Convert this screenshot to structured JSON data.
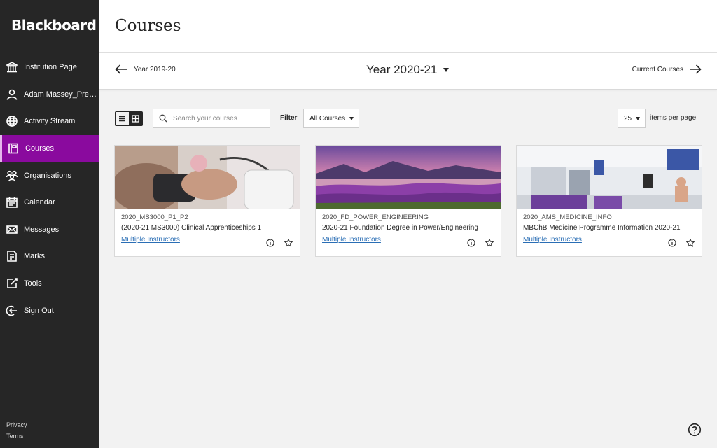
{
  "app": {
    "logo": "Blackboard",
    "accent": "#8a0a9e",
    "sidebar_bg": "#262626"
  },
  "sidebar": {
    "items": [
      {
        "label": "Institution Page",
        "icon": "institution-icon"
      },
      {
        "label": "Adam Massey_Previ...",
        "icon": "user-icon"
      },
      {
        "label": "Activity Stream",
        "icon": "globe-icon"
      },
      {
        "label": "Courses",
        "icon": "courses-icon",
        "active": true
      },
      {
        "label": "Organisations",
        "icon": "organisations-icon"
      },
      {
        "label": "Calendar",
        "icon": "calendar-icon"
      },
      {
        "label": "Messages",
        "icon": "messages-icon"
      },
      {
        "label": "Marks",
        "icon": "marks-icon"
      },
      {
        "label": "Tools",
        "icon": "tools-icon"
      },
      {
        "label": "Sign Out",
        "icon": "sign-out-icon"
      }
    ],
    "footer": {
      "privacy": "Privacy",
      "terms": "Terms"
    }
  },
  "header": {
    "title": "Courses"
  },
  "yearbar": {
    "prev_label": "Year 2019-20",
    "current": "Year 2020-21",
    "next_label": "Current Courses"
  },
  "toolbar": {
    "search_placeholder": "Search your courses",
    "filter_label": "Filter",
    "filter_value": "All Courses",
    "per_page_value": "25",
    "per_page_label": "items per page"
  },
  "courses": [
    {
      "code": "2020_MS3000_P1_P2",
      "name": "(2020-21 MS3000) Clinical Apprenticeships 1",
      "instructors": "Multiple Instructors"
    },
    {
      "code": "2020_FD_POWER_ENGINEERING",
      "name": "2020-21 Foundation Degree in Power/Engineering",
      "instructors": "Multiple Instructors"
    },
    {
      "code": "2020_AMS_MEDICINE_INFO",
      "name": "MBChB Medicine Programme Information 2020-21",
      "instructors": "Multiple Instructors"
    }
  ]
}
